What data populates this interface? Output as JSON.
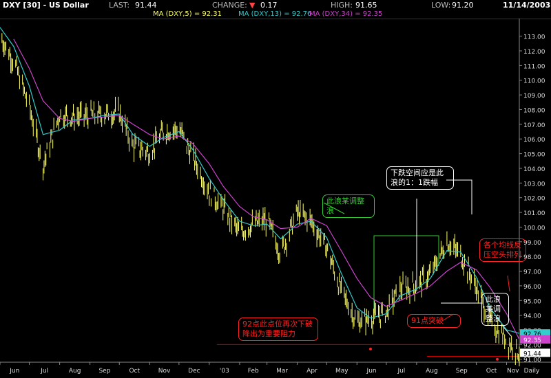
{
  "header": {
    "symbol": "DXY [30] - US Dollar",
    "last_label": "LAST:",
    "last_value": "91.44",
    "change_label": "CHANGE:",
    "change_value": "0.17",
    "high_label": "HIGH:",
    "high_value": "91.65",
    "low_label": "LOW:",
    "low_value": "91.20",
    "date": "11/14/2003",
    "ma5": "MA (DXY,5) = 92.31",
    "ma13": "MA (DXY,13) = 92.76",
    "ma34": "MA (DXY,34) = 92.35"
  },
  "colors": {
    "price": "#ffff66",
    "ma5": "#ffff66",
    "ma13": "#33cccc",
    "ma34": "#cc44cc",
    "annot_red": "#ff2222",
    "annot_green": "#33cc33",
    "support": "#cc0000"
  },
  "annotations": {
    "green_note": "此浪某调整浪",
    "white_note": "下跌空间应是此浪的1：1跌幅",
    "red_ma_note": "各个均线反压空头排列",
    "white_small_note": "此浪某调整浪",
    "break_note": "91点突破",
    "support_note": "92点此点位再次下破降出为重要阻力"
  },
  "chart_data": {
    "type": "line",
    "title": "DXY [30] - US Dollar",
    "xlabel": "",
    "ylabel": "",
    "x_tick_labels": [
      "Jun",
      "Jul",
      "Aug",
      "Sep",
      "Oct",
      "Nov",
      "Dec",
      "'03",
      "Feb",
      "Mar",
      "Apr",
      "May",
      "Jun",
      "Jul",
      "Aug",
      "Sep",
      "Oct",
      "Nov",
      "Daily"
    ],
    "y_tick_labels": [
      "91.00",
      "92.00",
      "93.00",
      "94.00",
      "95.00",
      "96.00",
      "97.00",
      "98.00",
      "99.00",
      "100.00",
      "101.00",
      "102.00",
      "103.00",
      "104.00",
      "105.00",
      "106.00",
      "107.00",
      "108.00",
      "109.00",
      "110.00",
      "111.00",
      "112.00",
      "113.00"
    ],
    "ylim": [
      90.8,
      114.2
    ],
    "grid": false,
    "x_range": [
      "2002-06-01",
      "2003-11-14"
    ],
    "last_value_markers": [
      {
        "label": "92.76",
        "series": "MA (DXY,13)"
      },
      {
        "label": "92.35",
        "series": "MA (DXY,34)"
      },
      {
        "label": "91.44",
        "series": "LAST"
      }
    ],
    "series": [
      {
        "name": "DXY",
        "x": [
          "2002-06-01",
          "2002-06-15",
          "2002-07-01",
          "2002-07-15",
          "2002-08-01",
          "2002-08-15",
          "2002-09-01",
          "2002-09-15",
          "2002-10-01",
          "2002-10-15",
          "2002-11-01",
          "2002-11-15",
          "2002-12-01",
          "2002-12-15",
          "2003-01-01",
          "2003-01-15",
          "2003-02-01",
          "2003-02-15",
          "2003-03-01",
          "2003-03-15",
          "2003-04-01",
          "2003-04-15",
          "2003-05-01",
          "2003-05-15",
          "2003-06-01",
          "2003-06-15",
          "2003-07-01",
          "2003-07-15",
          "2003-08-01",
          "2003-08-15",
          "2003-09-01",
          "2003-09-15",
          "2003-10-01",
          "2003-10-15",
          "2003-11-01",
          "2003-11-14"
        ],
        "y": [
          113.0,
          111.3,
          108.2,
          104.2,
          107.7,
          107.5,
          107.6,
          107.7,
          107.8,
          105.5,
          105.1,
          106.5,
          106.7,
          104.8,
          102.4,
          101.3,
          99.6,
          100.2,
          100.5,
          98.2,
          101.0,
          100.4,
          98.6,
          95.8,
          93.5,
          93.8,
          94.2,
          95.8,
          96.0,
          96.8,
          99.0,
          98.1,
          95.9,
          93.6,
          92.3,
          91.44
        ]
      },
      {
        "name": "MA (DXY,13)",
        "x": [
          "2002-06-01",
          "2002-06-15",
          "2002-07-01",
          "2002-07-15",
          "2002-08-01",
          "2002-08-15",
          "2002-09-01",
          "2002-09-15",
          "2002-10-01",
          "2002-10-15",
          "2002-11-01",
          "2002-11-15",
          "2002-12-01",
          "2002-12-15",
          "2003-01-01",
          "2003-01-15",
          "2003-02-01",
          "2003-02-15",
          "2003-03-01",
          "2003-03-15",
          "2003-04-01",
          "2003-04-15",
          "2003-05-01",
          "2003-05-15",
          "2003-06-01",
          "2003-06-15",
          "2003-07-01",
          "2003-07-15",
          "2003-08-01",
          "2003-08-15",
          "2003-09-01",
          "2003-09-15",
          "2003-10-01",
          "2003-10-15",
          "2003-11-01",
          "2003-11-14"
        ],
        "y": [
          113.6,
          112.3,
          109.6,
          106.3,
          106.6,
          107.3,
          107.4,
          107.6,
          107.7,
          106.3,
          105.5,
          106.1,
          106.5,
          105.3,
          103.3,
          101.9,
          100.4,
          100.1,
          100.2,
          99.2,
          100.2,
          100.4,
          99.3,
          97.0,
          94.5,
          93.8,
          94.1,
          95.3,
          95.8,
          96.5,
          98.4,
          98.3,
          96.6,
          94.5,
          93.0,
          92.76
        ]
      },
      {
        "name": "MA (DXY,34)",
        "x": [
          "2002-06-15",
          "2002-07-01",
          "2002-07-15",
          "2002-08-01",
          "2002-08-15",
          "2002-09-01",
          "2002-09-15",
          "2002-10-01",
          "2002-10-15",
          "2002-11-01",
          "2002-11-15",
          "2002-12-01",
          "2002-12-15",
          "2003-01-01",
          "2003-01-15",
          "2003-02-01",
          "2003-02-15",
          "2003-03-01",
          "2003-03-15",
          "2003-04-01",
          "2003-04-15",
          "2003-05-01",
          "2003-05-15",
          "2003-06-01",
          "2003-06-15",
          "2003-07-01",
          "2003-07-15",
          "2003-08-01",
          "2003-08-15",
          "2003-09-01",
          "2003-09-15",
          "2003-10-01",
          "2003-10-15",
          "2003-11-01",
          "2003-11-14"
        ],
        "y": [
          112.8,
          110.8,
          108.6,
          107.4,
          107.2,
          107.4,
          107.5,
          107.6,
          107.0,
          106.3,
          106.0,
          106.2,
          105.7,
          104.3,
          102.8,
          101.4,
          100.7,
          100.5,
          99.9,
          100.0,
          100.6,
          100.1,
          98.5,
          96.5,
          95.2,
          94.6,
          95.0,
          95.5,
          96.0,
          97.0,
          97.6,
          97.1,
          95.9,
          94.1,
          92.35
        ]
      }
    ]
  }
}
